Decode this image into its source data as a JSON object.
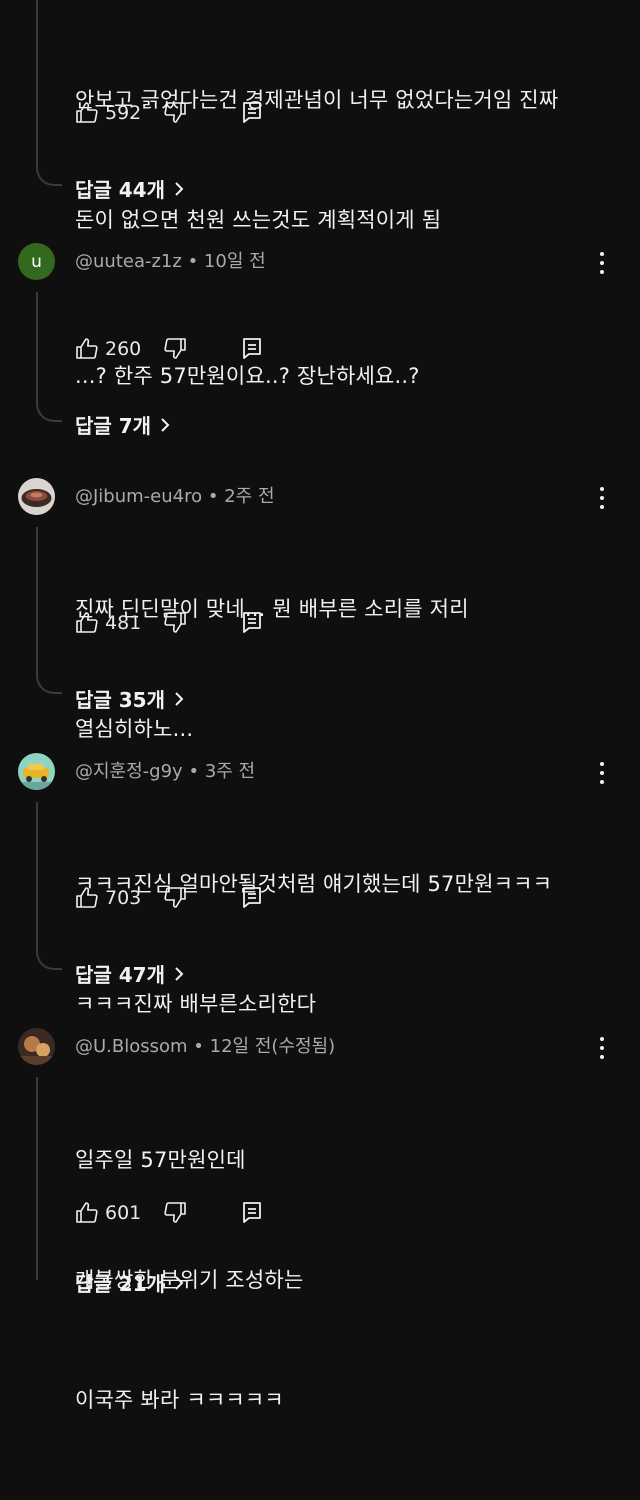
{
  "comments": [
    {
      "handle": "",
      "time": "",
      "lines": [
        "안보고 긁었다는건 경제관념이 너무 없었다는거임 진짜",
        "돈이 없으면 천원 쓰는것도 계획적이게 됨"
      ],
      "likes": "592",
      "replies": "답글 44개"
    },
    {
      "avatar_letter": "u",
      "handle": "@uutea-z1z",
      "time": "10일 전",
      "lines": [
        "...? 한주 57만원이요..? 장난하세요..?"
      ],
      "likes": "260",
      "replies": "답글 7개"
    },
    {
      "handle": "@Jibum-eu4ro",
      "time": "2주 전",
      "lines": [
        "진짜 딘딘말이 맞네... 뭔 배부른 소리를 저리",
        "열심히하노..."
      ],
      "likes": "481",
      "replies": "답글 35개"
    },
    {
      "handle": "@지훈정-g9y",
      "time": "3주 전",
      "lines": [
        "ㅋㅋㅋ진심 얼마안될것처럼 얘기했는데 57만원ㅋㅋㅋ",
        "ㅋㅋㅋ진짜 배부른소리한다"
      ],
      "likes": "703",
      "replies": "답글 47개"
    },
    {
      "handle": "@U.Blossom",
      "time": "12일 전(수정됨)",
      "lines": [
        "일주일 57만원인데",
        "개불쌍한 분위기 조성하는",
        "이국주 봐라 ㅋㅋㅋㅋㅋ"
      ],
      "likes": "601",
      "replies": "답글 21개"
    }
  ],
  "meta_separator": "•",
  "colors": {
    "background": "#0f0f0f",
    "text": "#f1f1f1",
    "secondary": "#aaaaaa",
    "avatar_u": "#33691e"
  }
}
